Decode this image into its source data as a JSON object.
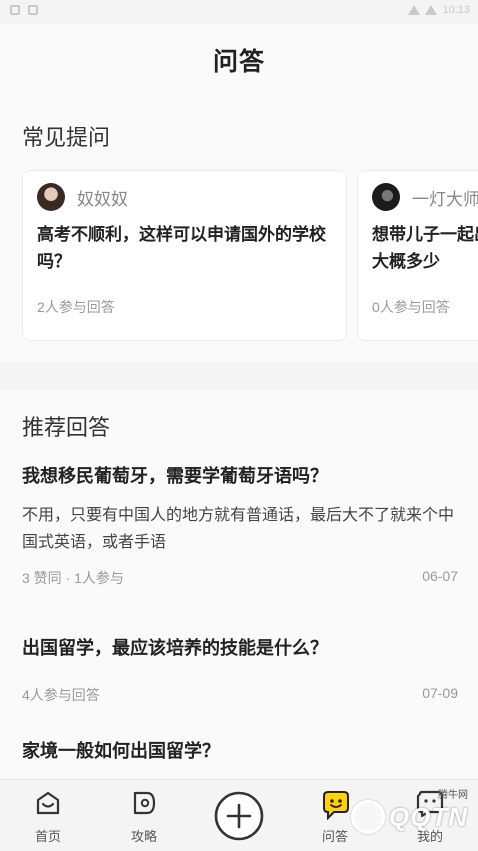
{
  "status_bar": {
    "time": "10:13"
  },
  "header": {
    "title": "问答"
  },
  "faq": {
    "title": "常见提问",
    "cards": [
      {
        "user": "奴奴奴",
        "question": "高考不顺利，这样可以申请国外的学校吗？",
        "meta": "2人参与回答"
      },
      {
        "user": "一灯大师",
        "question": "想带儿子一起出国，不知道一年生活费大概多少",
        "meta": "0人参与回答"
      }
    ]
  },
  "recommended": {
    "title": "推荐回答",
    "items": [
      {
        "question": "我想移民葡萄牙，需要学葡萄牙语吗？",
        "answer": "不用，只要有中国人的地方就有普通话，最后大不了就来个中国式英语，或者手语",
        "meta": "3 赞同 · 1人参与",
        "date": "06-07"
      },
      {
        "question": "出国留学，最应该培养的技能是什么？",
        "answer": "",
        "meta": "4人参与回答",
        "date": "07-09"
      },
      {
        "question": "家境一般如何出国留学？",
        "answer": "",
        "meta": "",
        "date": ""
      }
    ]
  },
  "tabbar": {
    "home": "首页",
    "guide": "攻略",
    "add": "",
    "qa": "问答",
    "me": "我的"
  },
  "watermark": {
    "text": "QQTN",
    "small": "腾牛网"
  },
  "colors": {
    "accent": "#ffd200",
    "text": "#222222",
    "muted": "#999999"
  }
}
